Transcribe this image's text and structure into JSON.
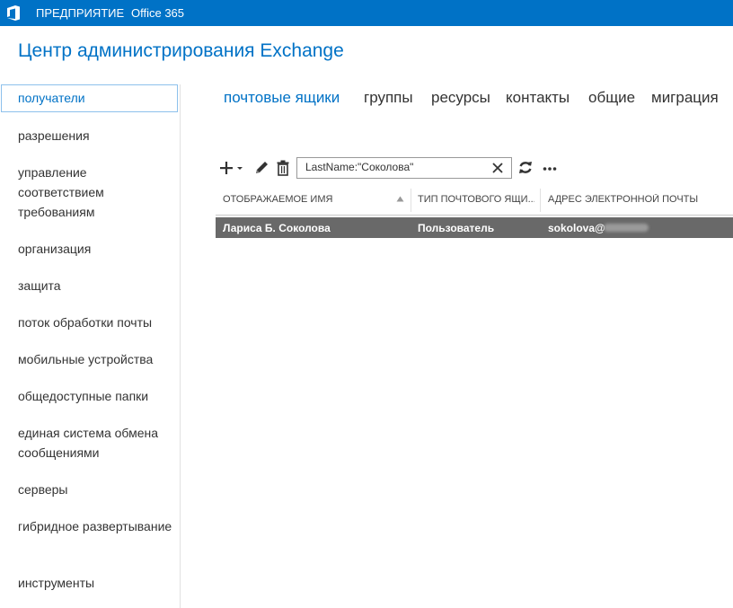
{
  "topbar": {
    "brand_icon": "office-logo-icon",
    "enterprise": "ПРЕДПРИЯТИЕ",
    "office365": "Office 365"
  },
  "app": {
    "title": "Центр администрирования Exchange"
  },
  "sidebar": {
    "items": [
      {
        "label": "получатели",
        "selected": true
      },
      {
        "label": "разрешения"
      },
      {
        "label": "управление соответствием требованиям"
      },
      {
        "label": "организация"
      },
      {
        "label": "защита"
      },
      {
        "label": "поток обработки почты"
      },
      {
        "label": "мобильные устройства"
      },
      {
        "label": "общедоступные папки"
      },
      {
        "label": "единая система обмена сообщениями"
      },
      {
        "label": "серверы"
      },
      {
        "label": "гибридное развертывание"
      },
      {
        "label": "инструменты"
      }
    ]
  },
  "tabs": [
    {
      "label": "почтовые ящики",
      "active": true
    },
    {
      "label": "группы"
    },
    {
      "label": "ресурсы"
    },
    {
      "label": "контакты"
    },
    {
      "label": "общие"
    },
    {
      "label": "миграция"
    }
  ],
  "toolbar": {
    "icons": [
      "add-icon",
      "edit-icon",
      "delete-icon",
      "clear-icon",
      "refresh-icon",
      "more-icon"
    ],
    "search_value": "LastName:\"Соколова\""
  },
  "table": {
    "columns": [
      "ОТОБРАЖАЕМОЕ ИМЯ",
      "ТИП ПОЧТОВОГО ЯЩИ...",
      "АДРЕС ЭЛЕКТРОННОЙ ПОЧТЫ"
    ],
    "rows": [
      {
        "name": "Лариса Б. Соколова",
        "type": "Пользователь",
        "email": "sokolova@"
      }
    ]
  },
  "colors": {
    "accent": "#0072c6",
    "selected_row": "#696969"
  }
}
